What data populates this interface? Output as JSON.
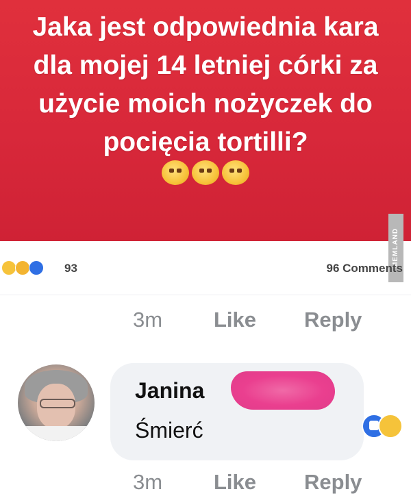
{
  "post": {
    "lines": [
      "Jaka jest odpowiednia kara",
      "dla mojej 14 letniej córki za",
      "użycie moich nożyczek do",
      "pocięcia tortilli?"
    ],
    "emoji_icons": [
      "grimace-emoji-icon",
      "grimace-emoji-icon",
      "grimace-emoji-icon"
    ]
  },
  "reactions": {
    "count": "93",
    "comments": "96 Comments",
    "icons": [
      "haha-reaction-icon",
      "wow-reaction-icon",
      "like-reaction-icon"
    ]
  },
  "actions_top": {
    "time": "3m",
    "like": "Like",
    "reply": "Reply"
  },
  "comment": {
    "author": "Janina",
    "text": "Śmierć",
    "reaction_icons": [
      "like-reaction-icon",
      "haha-reaction-icon"
    ]
  },
  "actions_bottom": {
    "time": "3m",
    "like": "Like",
    "reply": "Reply"
  },
  "watermark": "MEMLAND",
  "colors": {
    "post_bg": "#d8283a",
    "bubble_bg": "#f0f2f5",
    "meta_text": "#8a8d91",
    "like_blue": "#2f6fe4",
    "scribble_pink": "#ea3f8f"
  }
}
